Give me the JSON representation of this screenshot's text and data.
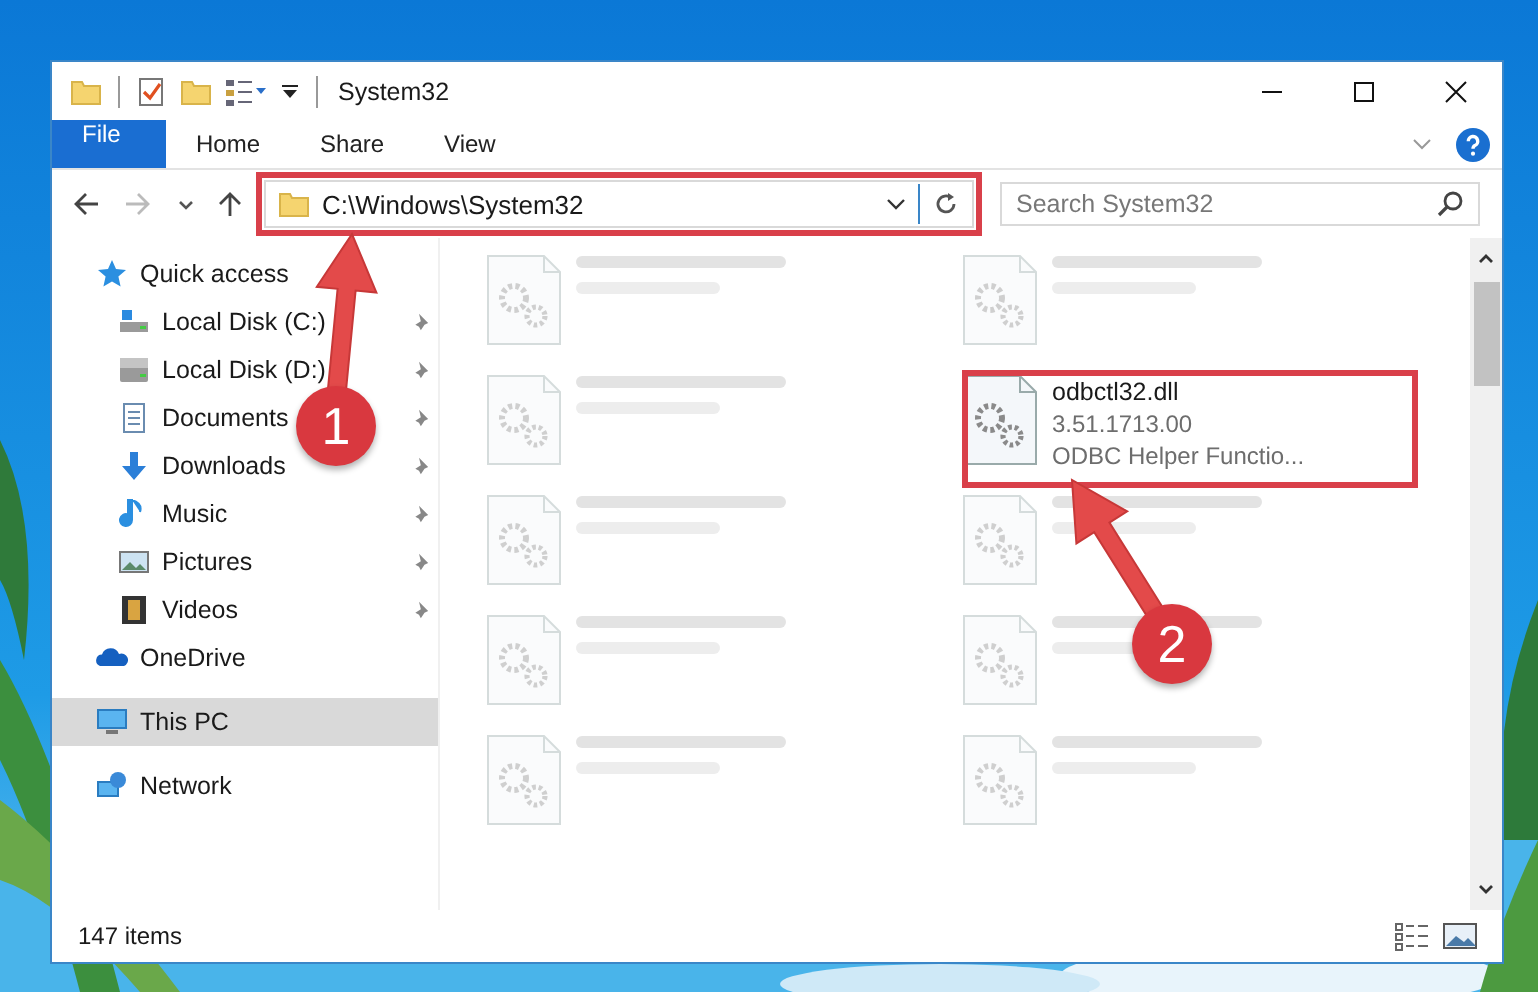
{
  "window": {
    "title": "System32"
  },
  "ribbon_tabs": [
    {
      "label": "File",
      "kind": "file"
    },
    {
      "label": "Home",
      "kind": "tab"
    },
    {
      "label": "Share",
      "kind": "tab"
    },
    {
      "label": "View",
      "kind": "tab"
    }
  ],
  "address_bar": {
    "path": "C:\\Windows\\System32"
  },
  "search": {
    "placeholder": "Search System32"
  },
  "sidebar": {
    "items": [
      {
        "label": "Quick access",
        "kind": "star",
        "selected": false,
        "children": [
          {
            "label": "Local Disk (C:)",
            "kind": "drive-c",
            "selected": false,
            "pinned": true
          },
          {
            "label": "Local Disk (D:)",
            "kind": "drive",
            "selected": false,
            "pinned": true
          },
          {
            "label": "Documents",
            "kind": "documents",
            "selected": false,
            "pinned": true
          },
          {
            "label": "Downloads",
            "kind": "downloads",
            "selected": false,
            "pinned": true
          },
          {
            "label": "Music",
            "kind": "music",
            "selected": false,
            "pinned": true
          },
          {
            "label": "Pictures",
            "kind": "pictures",
            "selected": false,
            "pinned": true
          },
          {
            "label": "Videos",
            "kind": "videos",
            "selected": false,
            "pinned": true
          }
        ]
      },
      {
        "label": "OneDrive",
        "kind": "onedrive",
        "selected": false
      },
      {
        "label": "This PC",
        "kind": "pc",
        "selected": true
      },
      {
        "label": "Network",
        "kind": "network",
        "selected": false
      }
    ]
  },
  "files": [
    {
      "kind": "blurred"
    },
    {
      "kind": "blurred"
    },
    {
      "kind": "blurred"
    },
    {
      "kind": "clear",
      "lines": [
        "odbctl32.dll",
        "3.51.1713.00",
        "ODBC Helper Functio..."
      ]
    },
    {
      "kind": "blurred"
    },
    {
      "kind": "blurred"
    },
    {
      "kind": "blurred"
    },
    {
      "kind": "blurred"
    },
    {
      "kind": "blurred"
    },
    {
      "kind": "blurred"
    }
  ],
  "status_bar": {
    "count": "147 items"
  },
  "annotations": [
    {
      "number": "1"
    },
    {
      "number": "2"
    }
  ]
}
